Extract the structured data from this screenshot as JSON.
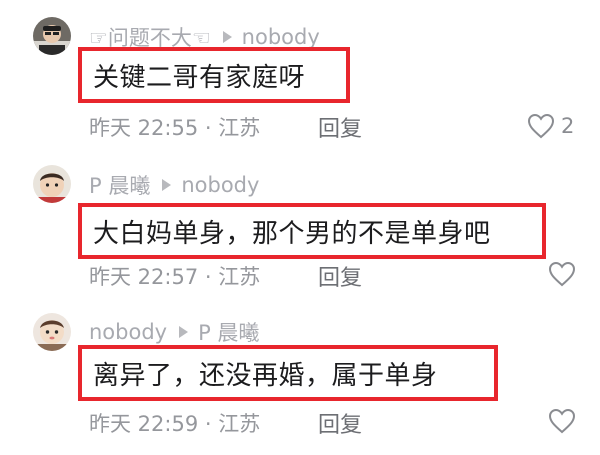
{
  "comments": [
    {
      "author": "☞问题不大☜",
      "reply_to": "nobody",
      "text": "关键二哥有家庭呀",
      "time": "昨天 22:55 · 江苏",
      "reply_label": "回复",
      "likes": "2"
    },
    {
      "author": "P 晨曦",
      "reply_to": "nobody",
      "text": "大白妈单身，那个男的不是单身吧",
      "time": "昨天 22:57 · 江苏",
      "reply_label": "回复",
      "likes": ""
    },
    {
      "author": "nobody",
      "reply_to": "P 晨曦",
      "text": "离异了，还没再婚，属于单身",
      "time": "昨天 22:59 · 江苏",
      "reply_label": "回复",
      "likes": ""
    }
  ],
  "colors": {
    "highlight": "#e8262d",
    "author": "#a8aab0",
    "text": "#1c1c1e",
    "meta": "#95979c"
  },
  "icons": {
    "reply_arrow": "triangle-right-icon",
    "like": "heart-outline-icon"
  }
}
